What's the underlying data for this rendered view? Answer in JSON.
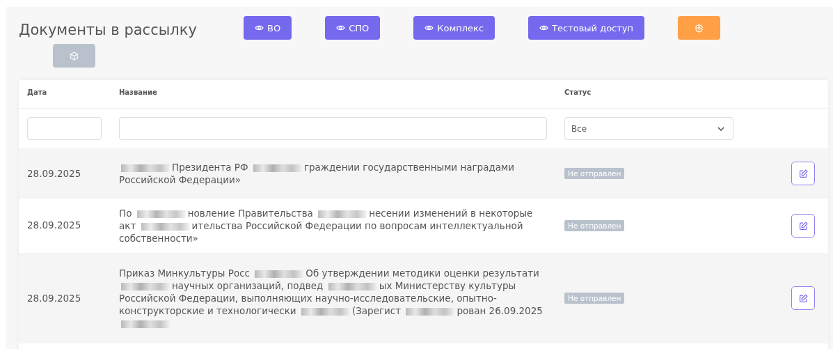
{
  "title": "Документы в рассылку",
  "header_buttons": [
    {
      "kind": "view",
      "label": "ВО"
    },
    {
      "kind": "view",
      "label": "СПО"
    },
    {
      "kind": "view",
      "label": "Комплекс"
    },
    {
      "kind": "view",
      "label": "Тестовый доступ"
    },
    {
      "kind": "settings"
    }
  ],
  "table": {
    "columns": [
      "Дата",
      "Название",
      "Статус"
    ],
    "filters": {
      "status": "Все"
    },
    "rows": [
      {
        "date": "28.09.2025",
        "title": [
          {
            "kind": "redacted"
          },
          {
            "kind": "text",
            "text": "Президента РФ"
          },
          {
            "kind": "redacted"
          },
          {
            "kind": "text",
            "text": "граждении государственными наградами Российской Федерации»"
          }
        ],
        "status": "Не отправлен"
      },
      {
        "date": "28.09.2025",
        "title": [
          {
            "kind": "text",
            "text": "По"
          },
          {
            "kind": "redacted"
          },
          {
            "kind": "text",
            "text": "новление Правительства"
          },
          {
            "kind": "redacted"
          },
          {
            "kind": "text",
            "text": "несении изменений в некоторые акт"
          },
          {
            "kind": "redacted"
          },
          {
            "kind": "text",
            "text": "ительства Российской Федерации по вопросам интеллектуальной собственности»"
          }
        ],
        "status": "Не отправлен"
      },
      {
        "date": "28.09.2025",
        "title": [
          {
            "kind": "text",
            "text": "Приказ Минкультуры Росс"
          },
          {
            "kind": "redacted"
          },
          {
            "kind": "text",
            "text": "Об утверждении методики оценки результати"
          },
          {
            "kind": "redacted"
          },
          {
            "kind": "text",
            "text": "научных организаций, подвед"
          },
          {
            "kind": "redacted"
          },
          {
            "kind": "text",
            "text": "ых Министерству культуры Российской Федерации, выполняющих научно-исследовательские, опытно-конструкторские и технологически"
          },
          {
            "kind": "redacted"
          },
          {
            "kind": "text",
            "text": "(Зарегист"
          },
          {
            "kind": "redacted"
          },
          {
            "kind": "text",
            "text": "рован 26.09.2025"
          },
          {
            "kind": "redacted"
          }
        ],
        "status": "Не отправлен"
      }
    ]
  }
}
